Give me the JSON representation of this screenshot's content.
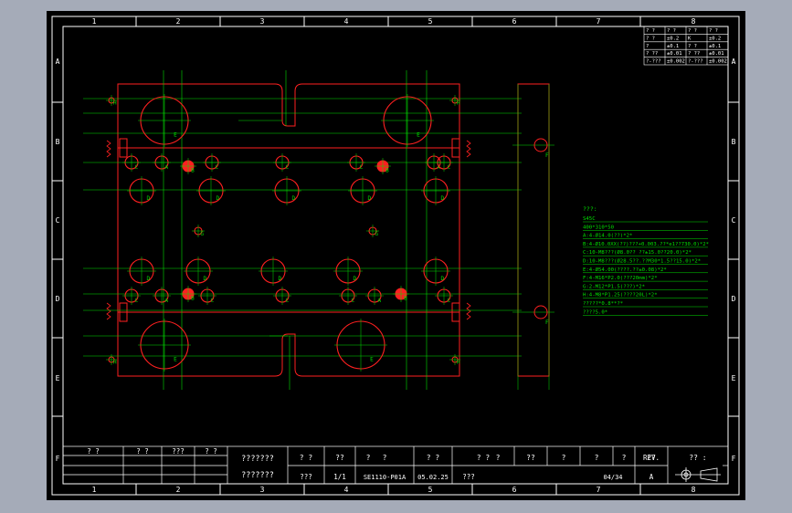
{
  "sheet": {
    "col_numbers": [
      "1",
      "2",
      "3",
      "4",
      "5",
      "6",
      "7",
      "8"
    ],
    "row_letters": [
      "A",
      "B",
      "C",
      "D",
      "E",
      "F"
    ]
  },
  "tolerance_table": {
    "rows": [
      [
        "? ?",
        "? ?",
        "? ?",
        "? ?"
      ],
      [
        "? ?",
        "±0.2",
        "K",
        "±0.2"
      ],
      [
        "?",
        "±0.1",
        "? ?",
        "±0.1"
      ],
      [
        "? ??",
        "±0.01",
        "? ??",
        "±0.01"
      ],
      [
        "?-???",
        "±0.002",
        "?-???",
        "±0.002"
      ]
    ]
  },
  "notes": {
    "heading": "???:",
    "lines": [
      "S45C",
      "400*310*50",
      "A:4-Ø14.0(??)*2*",
      "B:4-Ø10.0XX(??)???+0.003.??*e1??730.0)*2*",
      "C:10-M8???(Ø8.0?? ??±15.0??20.0)*2*",
      "D:10-M8???(Ø28.5??.??M30*1.5??15.0)*2*",
      "E:4-Ø54.00(????.??±0.08)*2*",
      "F:4-M16*P2.0(???20mm)*2*",
      "G:2-M12*P1.5(???)*2*",
      "H:4-M8*P1.25(????20L)*2*",
      "?????*0.8**?*",
      "????5.0*"
    ]
  },
  "hole_labels": [
    "A",
    "B",
    "C",
    "D",
    "E",
    "F",
    "G",
    "H"
  ],
  "title_block": {
    "header_cells": [
      "? ?",
      "? ?",
      "???",
      "? ?"
    ],
    "company_line1": "???????",
    "company_line2": "???????",
    "row1": [
      "? ?",
      "??",
      "?",
      "?",
      "? ?",
      "? ?",
      "?",
      "??",
      "?",
      "?",
      "?",
      "??"
    ],
    "rev_label": "REV.",
    "rev_value": "A",
    "sheet_cell": "?? :",
    "drawer": "???",
    "scale": "1/1",
    "drawing_no": "SE1110-P01A",
    "date": "05.02.25",
    "material": "???",
    "sheet_count": "04/34"
  },
  "colors": {
    "background": "#000000",
    "border": "#ffffff",
    "outline": "#ff2020",
    "dimension": "#00e000",
    "frame_outer": "#a5abb8"
  }
}
